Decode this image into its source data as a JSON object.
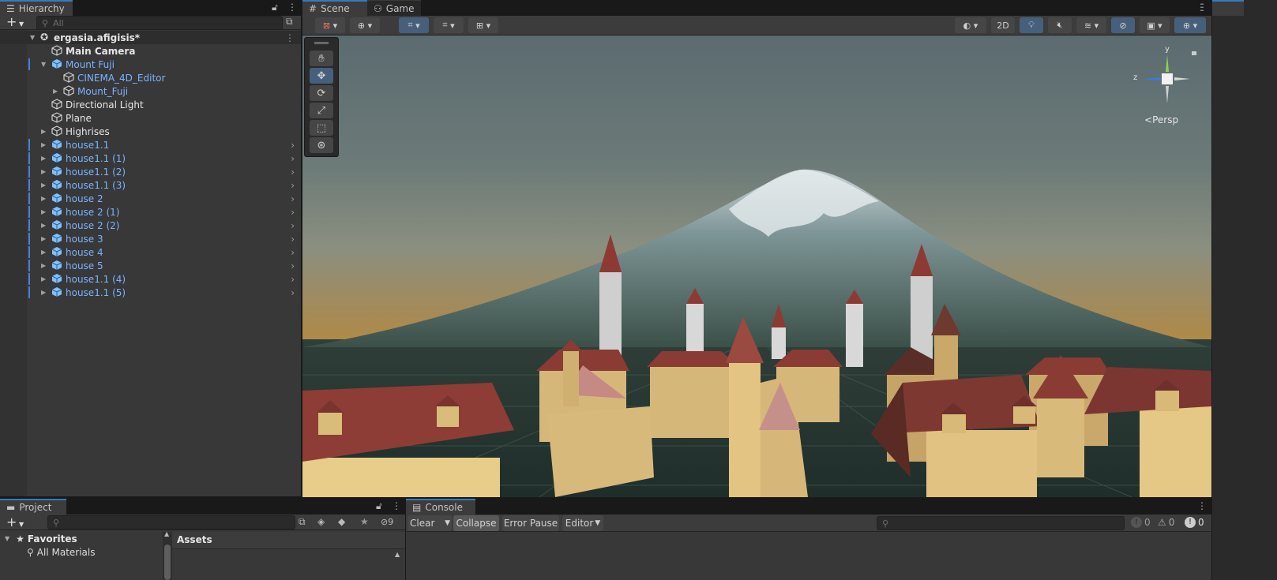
{
  "hierarchy": {
    "tab_label": "Hierarchy",
    "add_label": "+",
    "search_placeholder": "All",
    "scene_name": "ergasia.afigisis*",
    "items": [
      {
        "label": "Main Camera",
        "style": "white-bold"
      },
      {
        "label": "Mount Fuji",
        "style": "blue"
      },
      {
        "label": "CINEMA_4D_Editor",
        "style": "blue"
      },
      {
        "label": "Mount_Fuji",
        "style": "blue"
      },
      {
        "label": "Directional Light",
        "style": "white"
      },
      {
        "label": "Plane",
        "style": "white"
      },
      {
        "label": "Highrises",
        "style": "white"
      },
      {
        "label": "house1.1",
        "style": "blue"
      },
      {
        "label": "house1.1 (1)",
        "style": "blue"
      },
      {
        "label": "house1.1 (2)",
        "style": "blue"
      },
      {
        "label": "house1.1 (3)",
        "style": "blue"
      },
      {
        "label": "house 2",
        "style": "blue"
      },
      {
        "label": "house 2 (1)",
        "style": "blue"
      },
      {
        "label": "house 2 (2)",
        "style": "blue"
      },
      {
        "label": "house 3",
        "style": "blue"
      },
      {
        "label": "house 4",
        "style": "blue"
      },
      {
        "label": "house 5",
        "style": "blue"
      },
      {
        "label": "house1.1 (4)",
        "style": "blue"
      },
      {
        "label": "house1.1 (5)",
        "style": "blue"
      }
    ]
  },
  "scene": {
    "tab_scene": "Scene",
    "tab_game": "Game",
    "toggle_2d": "2D",
    "gizmo_y": "y",
    "gizmo_z": "z",
    "projection": "Persp"
  },
  "tools": [
    "hand-tool",
    "move-tool",
    "rotate-tool",
    "scale-tool",
    "rect-tool",
    "transform-tool"
  ],
  "project": {
    "tab_label": "Project",
    "add_label": "+",
    "hidden_count": "9",
    "favorites_label": "Favorites",
    "all_materials_label": "All Materials",
    "assets_label": "Assets"
  },
  "console": {
    "tab_label": "Console",
    "clear_label": "Clear",
    "collapse_label": "Collapse",
    "error_pause_label": "Error Pause",
    "editor_label": "Editor",
    "info_count": "0",
    "warning_count": "0",
    "error_count": "0"
  },
  "colors": {
    "accent": "#3a79bb",
    "selected_text": "#7bb3ff",
    "panel": "#383838",
    "toolbar": "#3c3c3c"
  }
}
